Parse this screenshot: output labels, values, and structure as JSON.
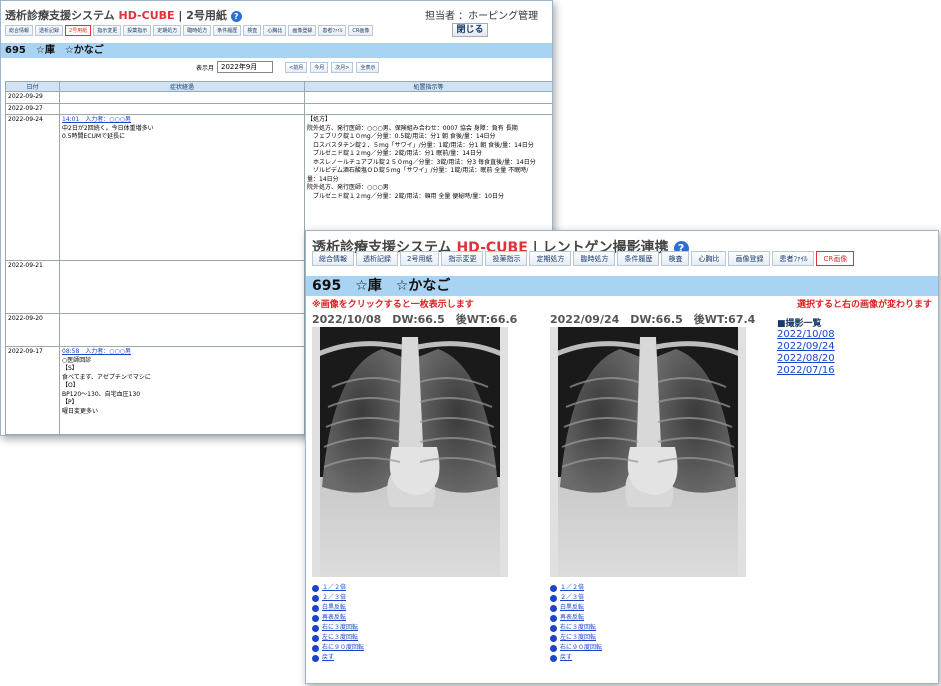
{
  "win1": {
    "app_title_main": "透析診療支援システム",
    "brand": "HD-CUBE",
    "page": "| 2号用紙",
    "charge": "担当者 ：ホーピング管理",
    "close_label": "閉じる",
    "tabs": [
      "総合情報",
      "透析記録",
      "2号用紙",
      "指示変更",
      "投薬指示",
      "定期処方",
      "臨時処方",
      "条件履歴",
      "検査",
      "心胸比",
      "画像登録",
      "患者ﾌｧｲﾙ",
      "CR画像"
    ],
    "active_tab_index": 2,
    "patient": "695　☆庫　☆かなご",
    "month_label": "表示月",
    "month_value": "2022年9月",
    "month_buttons": [
      "<前月",
      "今月",
      "次月>",
      "全表示"
    ],
    "headers": [
      "日付",
      "症状経過",
      "処置指示等"
    ],
    "rows": [
      {
        "date": "2022-09-29",
        "progress": [],
        "orders": []
      },
      {
        "date": "2022-09-27",
        "progress": [],
        "orders": []
      },
      {
        "date": "2022-09-24",
        "entry": "14:01　入力者：○○○男",
        "progress": [
          "中2日が2回続く。今日体重増多い",
          "0.5時間ECUMで延長に"
        ],
        "orders": [
          "【処方】",
          "院外処方、発行医師：○○○男、保険組み合わせ：0007 協会 身障：負有 長期",
          "　フェブリク錠１０mg／分量：0.5錠/用法：分1 朝 食後/量：14日分",
          "　ロスバスタチン錠２．５mg「サワイ」/分量：1錠/用法：分1 朝 食後/量：14日分",
          "　ブルゼニド錠１２mg／分量：2錠/用法：分1 眠前/量：14日分",
          "　ホスレノールチュアブル錠２５０mg／分量：3錠/用法：分3 毎食直後/量：14日分",
          "　ゾルピデム酒石酸塩ＯＤ錠５mg「サワイ」/分量：1錠/用法：眠前 全量 不眠時/",
          "量：14日分",
          "院外処方、発行医師：○○○男",
          "　ブルゼニド錠１２mg／分量：2錠/用法：頓用 全量 便秘時/量：10日分"
        ]
      },
      {
        "date": "2022-09-21",
        "progress": [],
        "orders": []
      },
      {
        "date": "2022-09-20",
        "progress": [],
        "orders": []
      },
      {
        "date": "2022-09-17",
        "entry": "08:58　入力者：○○○男",
        "progress": [
          "○医師回診",
          "【S】",
          "食べてます、アゼプチンでマシに",
          "【O】",
          "BP120～130、自宅血圧130",
          "【P】",
          "曜日変更多い"
        ],
        "orders": []
      }
    ]
  },
  "win2": {
    "app_title_main": "透析診療支援システム",
    "brand": "HD-CUBE",
    "page": "| レントゲン撮影連携",
    "tabs": [
      "総合情報",
      "透析記録",
      "2号用紙",
      "指示変更",
      "投薬指示",
      "定期処方",
      "臨時処方",
      "条件履歴",
      "検査",
      "心胸比",
      "画像登録",
      "患者ﾌｧｲﾙ",
      "CR画像"
    ],
    "active_tab_index": 12,
    "patient": "695　☆庫　☆かなご",
    "notice_left": "※画像をクリックすると一枚表示します",
    "notice_right": "選択すると右の画像が変わります",
    "image1_caption": "2022/10/08　DW:66.5　後WT:66.6",
    "image2_caption": "2022/09/24　DW:66.5　後WT:67.4",
    "image_links": [
      "１／２倍",
      "２／３倍",
      "白黒反転",
      "再表反転",
      "右に３度回転",
      "左に３度回転",
      "右に９０度回転",
      "戻す"
    ],
    "history_title": "■撮影一覧",
    "history": [
      "2022/10/08",
      "2022/09/24",
      "2022/08/20",
      "2022/07/16"
    ]
  }
}
